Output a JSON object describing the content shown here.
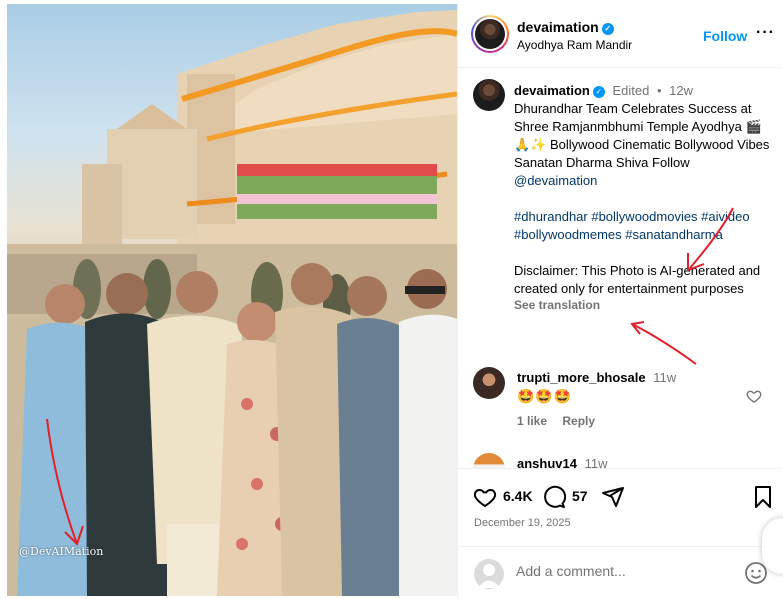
{
  "photo": {
    "watermark": "@DevAIMation"
  },
  "header": {
    "username": "devaimation",
    "location": "Ayodhya Ram Mandir",
    "follow_label": "Follow",
    "more_label": "···"
  },
  "caption": {
    "username": "devaimation",
    "edited_label": "Edited",
    "separator": "•",
    "time": "12w",
    "text": "Dhurandhar Team Celebrates Success at Shree Ramjanmbhumi Temple Ayodhya 🎬🙏✨ Bollywood Cinematic Bollywood Vibes Sanatan Dharma Shiva Follow ",
    "mention": "@devaimation",
    "hashtags": "#dhurandhar #bollywoodmovies #aivideo #bollywoodmemes #sanatandharma",
    "disclaimer": "Disclaimer: This Photo is AI-generated and created only for entertainment purposes",
    "see_translation": "See translation"
  },
  "comments": [
    {
      "username": "trupti_more_bhosale",
      "time": "11w",
      "text": "🤩🤩🤩",
      "likes": "1 like",
      "reply_label": "Reply"
    },
    {
      "username": "anshuv14",
      "time": "11w"
    }
  ],
  "actions": {
    "likes_count": "6.4K",
    "comments_count": "57",
    "date": "December 19, 2025"
  },
  "add_comment": {
    "placeholder": "Add a comment..."
  },
  "colors": {
    "link": "#00376b",
    "accent": "#0095f6",
    "muted": "#737373",
    "annotation_red": "#e0202a"
  },
  "icons": [
    "verified-badge-icon",
    "more-options-icon",
    "heart-icon",
    "comment-icon",
    "share-icon",
    "bookmark-icon",
    "emoji-icon",
    "user-placeholder-icon"
  ]
}
